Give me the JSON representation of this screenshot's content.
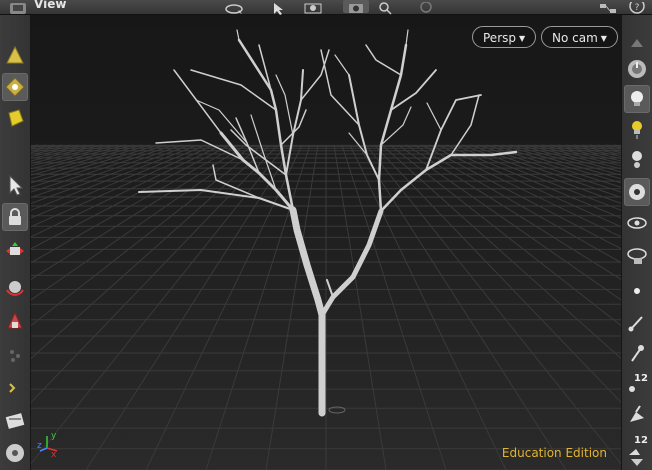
{
  "app": {
    "pane_title": "View",
    "edition_label": "Education Edition"
  },
  "viewport": {
    "camera_view": "Persp",
    "camera_select": "No cam"
  },
  "right_toolbar": {
    "badge_a": "12",
    "badge_b": "12"
  },
  "axes": {
    "x_label": "x",
    "y_label": "y",
    "z_label": "z"
  },
  "colors": {
    "edition_text": "#e1b52e",
    "axis_x": "#d33",
    "axis_y": "#3c3",
    "axis_z": "#48f",
    "tree": "#c8c8c8"
  },
  "icons": {
    "select": "arrow-select-icon",
    "lock": "lock-icon",
    "light": "light-bulb-icon",
    "camera": "camera-icon"
  }
}
